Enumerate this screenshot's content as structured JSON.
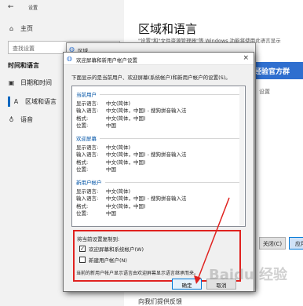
{
  "settings": {
    "app_title": "设置",
    "back_icon": "back-arrow-icon",
    "nav_home": "主页",
    "search_placeholder": "查找设置",
    "group": "时间和语言",
    "nav_items": [
      {
        "label": "日期和时间",
        "icon": "calendar-clock-icon"
      },
      {
        "label": "区域和语言",
        "icon": "language-icon"
      },
      {
        "label": "语音",
        "icon": "microphone-icon"
      }
    ],
    "heading": "区域和语言",
    "description": "\"设置\"和\"文件资源管理器\"等 Windows 功能将使用此语言显示",
    "blue_chip": "经验官方群",
    "settings_frag": "设置",
    "bottom_link": "向我们提供反馈",
    "buttons": {
      "close": "关闭(C)",
      "apply": "应用"
    }
  },
  "region_dialog": {
    "title": "区域"
  },
  "welcome_dialog": {
    "title": "欢迎屏幕和新用户帐户设置",
    "intro": "下面显示的是当前用户、欢迎屏幕(系统帐户)和新用户帐户的设置(S)。",
    "sections": [
      {
        "title": "当前用户",
        "rows": [
          {
            "k": "显示语言:",
            "v": "中文(简体)"
          },
          {
            "k": "输入语言:",
            "v": "中文(简体，中国) - 搜狗拼音输入法"
          },
          {
            "k": "格式:",
            "v": "中文(简体，中国)"
          },
          {
            "k": "位置:",
            "v": "中国"
          }
        ]
      },
      {
        "title": "欢迎屏幕",
        "rows": [
          {
            "k": "显示语言:",
            "v": "中文(简体)"
          },
          {
            "k": "输入语言:",
            "v": "中文(简体，中国) - 搜狗拼音输入法"
          },
          {
            "k": "格式:",
            "v": "中文(简体，中国)"
          },
          {
            "k": "位置:",
            "v": "中国"
          }
        ]
      },
      {
        "title": "新用户帐户",
        "rows": [
          {
            "k": "显示语言:",
            "v": "中文(简体)"
          },
          {
            "k": "输入语言:",
            "v": "中文(简体，中国) - 搜狗拼音输入法"
          },
          {
            "k": "格式:",
            "v": "中文(简体，中国)"
          },
          {
            "k": "位置:",
            "v": "中国"
          }
        ]
      }
    ],
    "copy_label": "将当前设置复制到:",
    "checkbox_welcome": {
      "label": "欢迎屏幕和系统帐户(W)",
      "checked": true
    },
    "checkbox_new_user": {
      "label": "新建用户帐户(N)",
      "checked": false
    },
    "note": "当前的新用户帐户显示语言由欢迎屏幕显示语言继承而来。",
    "ok": "确定",
    "cancel": "取消"
  },
  "highlight_color": "#e0221f",
  "watermark": "Baidu 经验"
}
